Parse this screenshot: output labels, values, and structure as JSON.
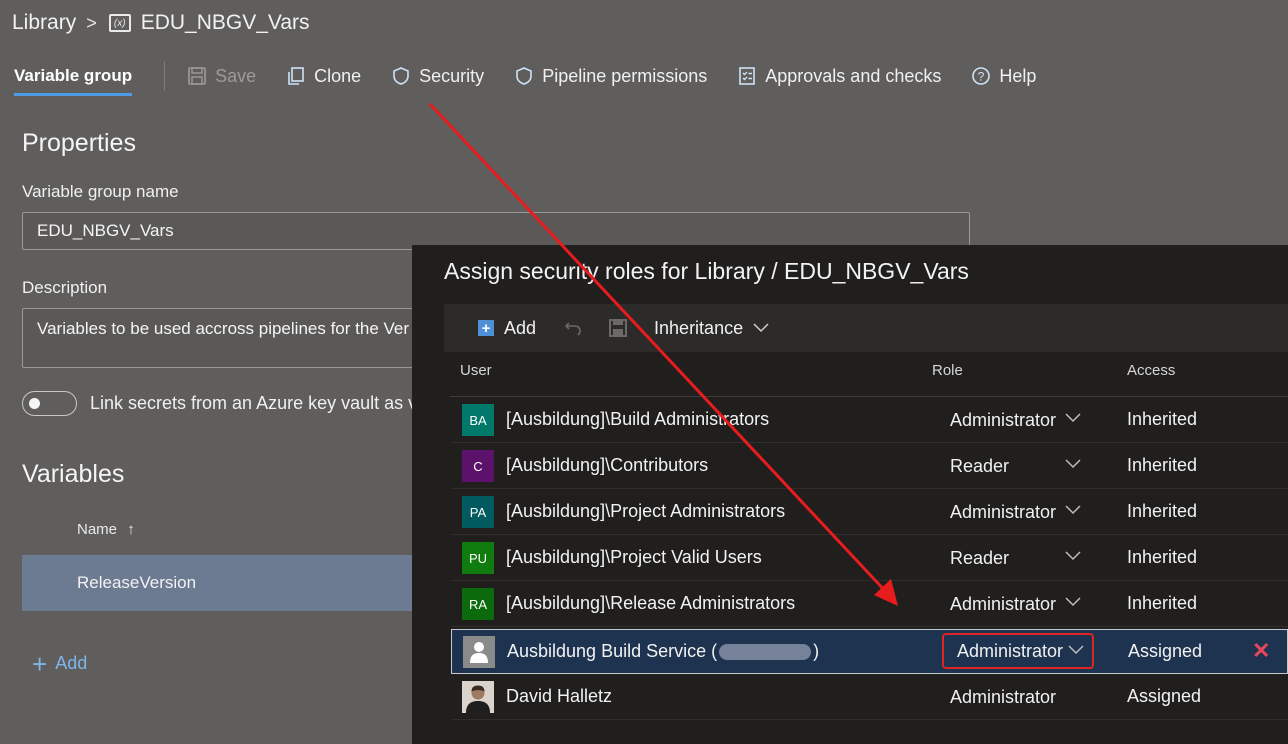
{
  "breadcrumb": {
    "root": "Library",
    "separator": ">",
    "current": "EDU_NBGV_Vars",
    "icon": "variable-group-icon"
  },
  "toolbar": {
    "active_tab": "Variable group",
    "buttons": [
      {
        "label": "Save",
        "icon": "save-icon",
        "enabled": false
      },
      {
        "label": "Clone",
        "icon": "clone-icon",
        "enabled": true
      },
      {
        "label": "Security",
        "icon": "shield-icon",
        "enabled": true
      },
      {
        "label": "Pipeline permissions",
        "icon": "shield-icon",
        "enabled": true
      },
      {
        "label": "Approvals and checks",
        "icon": "checklist-icon",
        "enabled": true
      },
      {
        "label": "Help",
        "icon": "help-icon",
        "enabled": true
      }
    ]
  },
  "properties": {
    "title": "Properties",
    "name_label": "Variable group name",
    "name_value": "EDU_NBGV_Vars",
    "description_label": "Description",
    "description_value": "Variables to be used accross pipelines for the Ver",
    "keyvault_label": "Link secrets from an Azure key vault as var",
    "keyvault_enabled": false
  },
  "variables": {
    "title": "Variables",
    "name_header": "Name",
    "sort_indicator": "↑",
    "rows": [
      "ReleaseVersion"
    ],
    "add_label": "Add"
  },
  "dialog": {
    "title": "Assign security roles for Library / EDU_NBGV_Vars",
    "add_label": "Add",
    "inheritance_label": "Inheritance",
    "headers": {
      "user": "User",
      "role": "Role",
      "access": "Access"
    },
    "rows": [
      {
        "initials": "BA",
        "color": "#00796b",
        "user": "[Ausbildung]\\Build Administrators",
        "role": "Administrator",
        "access": "Inherited"
      },
      {
        "initials": "C",
        "color": "#5c126b",
        "user": "[Ausbildung]\\Contributors",
        "role": "Reader",
        "access": "Inherited"
      },
      {
        "initials": "PA",
        "color": "#005a5f",
        "user": "[Ausbildung]\\Project Administrators",
        "role": "Administrator",
        "access": "Inherited"
      },
      {
        "initials": "PU",
        "color": "#107c10",
        "user": "[Ausbildung]\\Project Valid Users",
        "role": "Reader",
        "access": "Inherited"
      },
      {
        "initials": "RA",
        "color": "#0b6a0b",
        "user": "[Ausbildung]\\Release Administrators",
        "role": "Administrator",
        "access": "Inherited"
      },
      {
        "initials": "",
        "color": "#8a8a8a",
        "user_prefix": "Ausbildung Build Service (",
        "user_suffix": ")",
        "role": "Administrator",
        "access": "Assigned",
        "selected": true,
        "delete_symbol": "✕"
      },
      {
        "initials": "",
        "color": "#ddd6cf",
        "user": "David Halletz",
        "role": "Administrator",
        "access": "Assigned"
      }
    ]
  },
  "colors": {
    "accent": "#4f9be6",
    "highlight": "#e02424",
    "selected_row": "#1d3350"
  }
}
